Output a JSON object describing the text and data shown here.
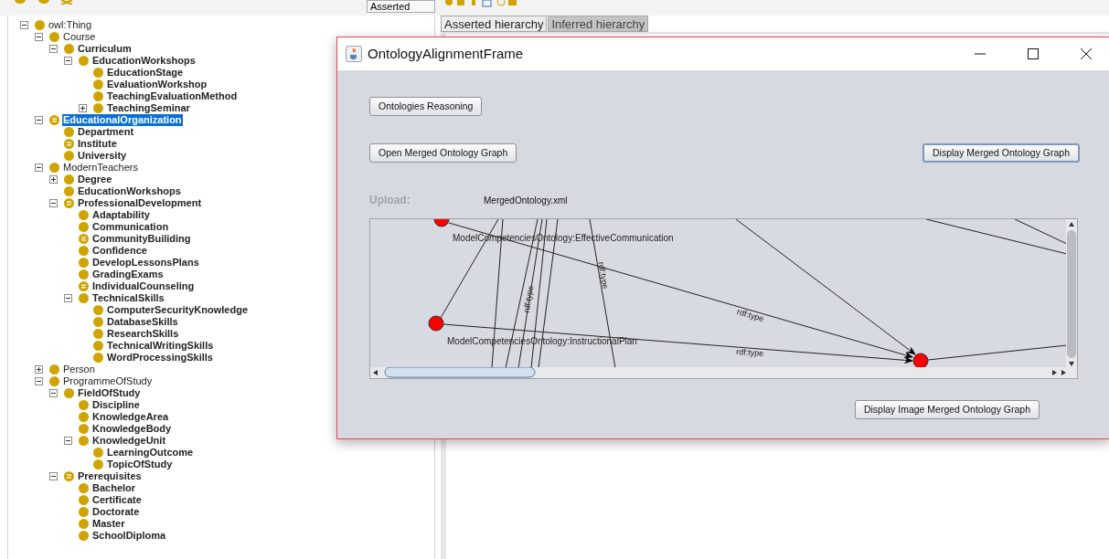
{
  "toolbar": {
    "hierarchy_mode": "Asserted"
  },
  "tabs": [
    {
      "label": "Asserted hierarchy",
      "selected": true
    },
    {
      "label": "Inferred hierarchy",
      "selected": false
    }
  ],
  "class_tree": [
    {
      "label": "owl:Thing",
      "kind": "class",
      "bold": false,
      "selected": false,
      "expanded": true,
      "children": [
        {
          "label": "Course",
          "kind": "class",
          "bold": false,
          "selected": false,
          "expanded": true,
          "children": [
            {
              "label": "Curriculum",
              "kind": "class",
              "bold": true,
              "selected": false,
              "expanded": true,
              "children": [
                {
                  "label": "EducationWorkshops",
                  "kind": "class",
                  "bold": true,
                  "selected": false,
                  "expanded": true,
                  "children": [
                    {
                      "label": "EducationStage",
                      "kind": "class",
                      "bold": true,
                      "selected": false
                    },
                    {
                      "label": "EvaluationWorkshop",
                      "kind": "class",
                      "bold": true,
                      "selected": false
                    },
                    {
                      "label": "TeachingEvaluationMethod",
                      "kind": "class",
                      "bold": true,
                      "selected": false
                    },
                    {
                      "label": "TeachingSeminar",
                      "kind": "class",
                      "bold": true,
                      "selected": false,
                      "expanded": false
                    }
                  ]
                }
              ]
            }
          ]
        },
        {
          "label": "EducationalOrganization",
          "kind": "defined",
          "bold": true,
          "selected": true,
          "expanded": true,
          "children": [
            {
              "label": "Department",
              "kind": "class",
              "bold": true,
              "selected": false
            },
            {
              "label": "Institute",
              "kind": "defined",
              "bold": true,
              "selected": false
            },
            {
              "label": "University",
              "kind": "class",
              "bold": true,
              "selected": false
            }
          ]
        },
        {
          "label": "ModernTeachers",
          "kind": "class",
          "bold": false,
          "selected": false,
          "expanded": true,
          "children": [
            {
              "label": "Degree",
              "kind": "class",
              "bold": true,
              "selected": false,
              "expanded": false
            },
            {
              "label": "EducationWorkshops",
              "kind": "class",
              "bold": true,
              "selected": false
            },
            {
              "label": "ProfessionalDevelopment",
              "kind": "defined",
              "bold": true,
              "selected": false,
              "expanded": true,
              "children": [
                {
                  "label": "Adaptability",
                  "kind": "class",
                  "bold": true,
                  "selected": false
                },
                {
                  "label": "Communication",
                  "kind": "class",
                  "bold": true,
                  "selected": false
                },
                {
                  "label": "CommunityBuiliding",
                  "kind": "defined",
                  "bold": true,
                  "selected": false
                },
                {
                  "label": "Confidence",
                  "kind": "class",
                  "bold": true,
                  "selected": false
                },
                {
                  "label": "DevelopLessonsPlans",
                  "kind": "class",
                  "bold": true,
                  "selected": false
                },
                {
                  "label": "GradingExams",
                  "kind": "class",
                  "bold": true,
                  "selected": false
                },
                {
                  "label": "IndividualCounseling",
                  "kind": "defined",
                  "bold": true,
                  "selected": false
                },
                {
                  "label": "TechnicalSkills",
                  "kind": "class",
                  "bold": true,
                  "selected": false,
                  "expanded": true,
                  "children": [
                    {
                      "label": "ComputerSecurityKnowledge",
                      "kind": "class",
                      "bold": true,
                      "selected": false
                    },
                    {
                      "label": "DatabaseSkills",
                      "kind": "class",
                      "bold": true,
                      "selected": false
                    },
                    {
                      "label": "ResearchSkills",
                      "kind": "class",
                      "bold": true,
                      "selected": false
                    },
                    {
                      "label": "TechnicalWritingSkills",
                      "kind": "class",
                      "bold": true,
                      "selected": false
                    },
                    {
                      "label": "WordProcessingSkills",
                      "kind": "class",
                      "bold": true,
                      "selected": false
                    }
                  ]
                }
              ]
            }
          ]
        },
        {
          "label": "Person",
          "kind": "class",
          "bold": false,
          "selected": false,
          "expanded": false
        },
        {
          "label": "ProgrammeOfStudy",
          "kind": "class",
          "bold": false,
          "selected": false,
          "expanded": true,
          "children": [
            {
              "label": "FieldOfStudy",
              "kind": "class",
              "bold": true,
              "selected": false,
              "expanded": true,
              "children": [
                {
                  "label": "Discipline",
                  "kind": "class",
                  "bold": true,
                  "selected": false
                },
                {
                  "label": "KnowledgeArea",
                  "kind": "class",
                  "bold": true,
                  "selected": false
                },
                {
                  "label": "KnowledgeBody",
                  "kind": "class",
                  "bold": true,
                  "selected": false
                },
                {
                  "label": "KnowledgeUnit",
                  "kind": "class",
                  "bold": true,
                  "selected": false,
                  "expanded": true,
                  "children": [
                    {
                      "label": "LearningOutcome",
                      "kind": "class",
                      "bold": true,
                      "selected": false
                    },
                    {
                      "label": "TopicOfStudy",
                      "kind": "class",
                      "bold": true,
                      "selected": false
                    }
                  ]
                }
              ]
            },
            {
              "label": "Prerequisites",
              "kind": "defined",
              "bold": true,
              "selected": false,
              "expanded": true,
              "children": [
                {
                  "label": "Bachelor",
                  "kind": "class",
                  "bold": true,
                  "selected": false
                },
                {
                  "label": "Certificate",
                  "kind": "class",
                  "bold": true,
                  "selected": false
                },
                {
                  "label": "Doctorate",
                  "kind": "class",
                  "bold": true,
                  "selected": false
                },
                {
                  "label": "Master",
                  "kind": "class",
                  "bold": true,
                  "selected": false
                },
                {
                  "label": "SchoolDiploma",
                  "kind": "class",
                  "bold": true,
                  "selected": false
                }
              ]
            }
          ]
        }
      ]
    }
  ],
  "dialog": {
    "title": "OntologyAlignmentFrame",
    "reasoning_button": {
      "label": "Ontologies Reasoning",
      "focused": false
    },
    "open_graph_button": {
      "label": "Open Merged Ontology Graph",
      "focused": false
    },
    "display_graph_button": {
      "label": "Display Merged Ontology Graph",
      "focused": true
    },
    "upload_label": "Upload:",
    "upload_file": "MergedOntology.xml",
    "graph": {
      "node_labels": [
        "ModelCompetenciesOntology:EffectiveCommunication",
        "ModelCompetenciesOntology:InstructionalPlan"
      ],
      "edge_labels": [
        "rdf:type",
        "rdf:type",
        "rdf:type",
        "rdf:type"
      ]
    },
    "display_image_button": {
      "label": "Display Image Merged Ontology Graph",
      "focused": false
    }
  }
}
